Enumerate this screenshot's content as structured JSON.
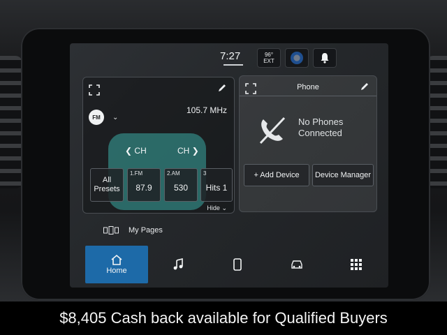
{
  "status": {
    "time": "7:27",
    "temperature": "96°",
    "temperature_label": "EXT"
  },
  "radio": {
    "band": "FM",
    "frequency": "105.7 MHz",
    "ch_left": "CH",
    "ch_right": "CH",
    "all_presets": [
      "All",
      "Presets"
    ],
    "presets": [
      {
        "num": "1.FM",
        "value": "87.9"
      },
      {
        "num": "2.AM",
        "value": "530"
      },
      {
        "num": "3",
        "value": "Hits 1"
      }
    ],
    "hide_label": "Hide"
  },
  "phone": {
    "title": "Phone",
    "status_line1": "No Phones",
    "status_line2": "Connected",
    "add_device": "+ Add Device",
    "device_manager": "Device Manager"
  },
  "my_pages": "My Pages",
  "nav": {
    "home": "Home"
  },
  "caption": "$8,405 Cash back available for Qualified Buyers",
  "colors": {
    "accent_blue": "#1d6aa8",
    "teal_glow": "#40c8be"
  }
}
